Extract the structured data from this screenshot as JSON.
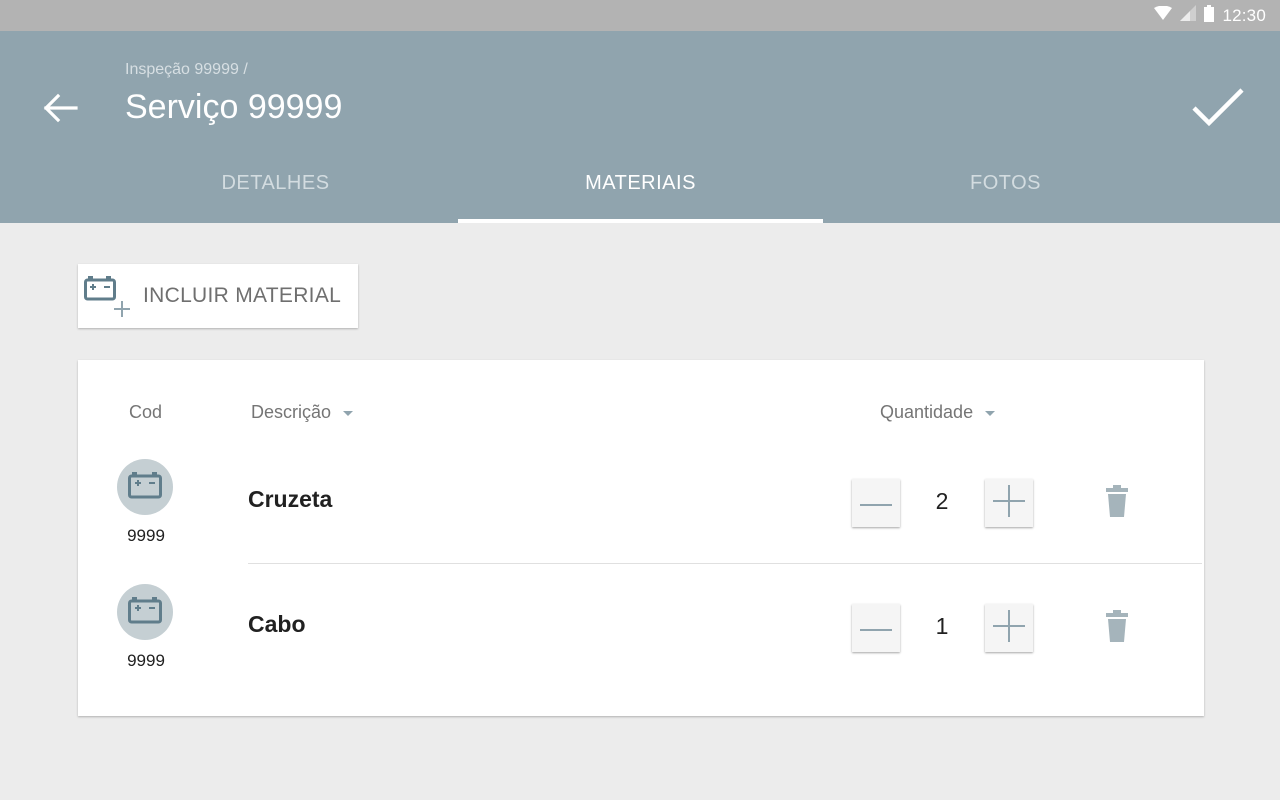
{
  "status_bar": {
    "time": "12:30",
    "icons": [
      "wifi-icon",
      "signal-icon",
      "battery-icon"
    ]
  },
  "header": {
    "breadcrumb": "Inspeção 99999 /",
    "title": "Serviço 99999",
    "back_icon": "arrow-back-icon",
    "confirm_icon": "check-icon"
  },
  "tabs": [
    {
      "label": "DETALHES",
      "active": false
    },
    {
      "label": "MATERIAIS",
      "active": true
    },
    {
      "label": "FOTOS",
      "active": false
    }
  ],
  "include_button": {
    "label": "INCLUIR MATERIAL",
    "icon": "add-battery-icon"
  },
  "table": {
    "headers": {
      "cod": "Cod",
      "descricao": "Descrição",
      "quantidade": "Quantidade"
    },
    "rows": [
      {
        "code": "9999",
        "description": "Cruzeta",
        "quantity": "2"
      },
      {
        "code": "9999",
        "description": "Cabo",
        "quantity": "1"
      }
    ]
  },
  "colors": {
    "app_bar": "#90a4ae",
    "status_bar": "#b3b3b3",
    "background": "#ececec",
    "icon": "#607d8b",
    "avatar": "#c5cfd3"
  }
}
